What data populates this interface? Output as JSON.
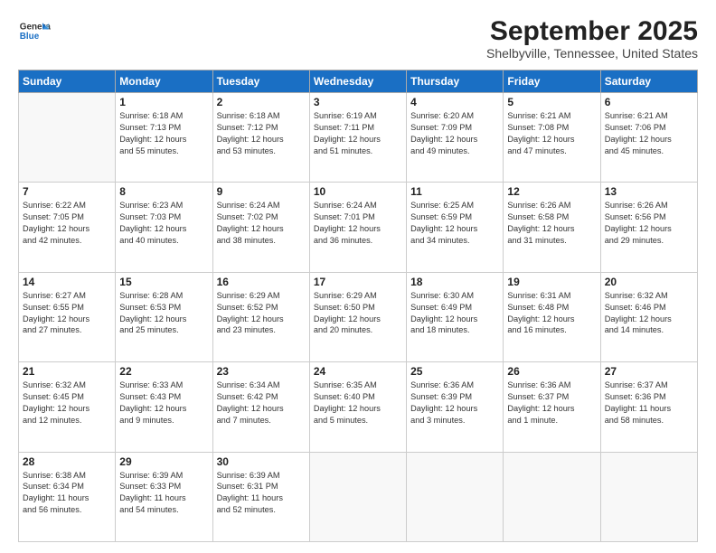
{
  "header": {
    "logo": {
      "general": "General",
      "blue": "Blue"
    },
    "title": "September 2025",
    "subtitle": "Shelbyville, Tennessee, United States"
  },
  "days_of_week": [
    "Sunday",
    "Monday",
    "Tuesday",
    "Wednesday",
    "Thursday",
    "Friday",
    "Saturday"
  ],
  "weeks": [
    [
      {
        "day": "",
        "info": ""
      },
      {
        "day": "1",
        "info": "Sunrise: 6:18 AM\nSunset: 7:13 PM\nDaylight: 12 hours\nand 55 minutes."
      },
      {
        "day": "2",
        "info": "Sunrise: 6:18 AM\nSunset: 7:12 PM\nDaylight: 12 hours\nand 53 minutes."
      },
      {
        "day": "3",
        "info": "Sunrise: 6:19 AM\nSunset: 7:11 PM\nDaylight: 12 hours\nand 51 minutes."
      },
      {
        "day": "4",
        "info": "Sunrise: 6:20 AM\nSunset: 7:09 PM\nDaylight: 12 hours\nand 49 minutes."
      },
      {
        "day": "5",
        "info": "Sunrise: 6:21 AM\nSunset: 7:08 PM\nDaylight: 12 hours\nand 47 minutes."
      },
      {
        "day": "6",
        "info": "Sunrise: 6:21 AM\nSunset: 7:06 PM\nDaylight: 12 hours\nand 45 minutes."
      }
    ],
    [
      {
        "day": "7",
        "info": "Sunrise: 6:22 AM\nSunset: 7:05 PM\nDaylight: 12 hours\nand 42 minutes."
      },
      {
        "day": "8",
        "info": "Sunrise: 6:23 AM\nSunset: 7:03 PM\nDaylight: 12 hours\nand 40 minutes."
      },
      {
        "day": "9",
        "info": "Sunrise: 6:24 AM\nSunset: 7:02 PM\nDaylight: 12 hours\nand 38 minutes."
      },
      {
        "day": "10",
        "info": "Sunrise: 6:24 AM\nSunset: 7:01 PM\nDaylight: 12 hours\nand 36 minutes."
      },
      {
        "day": "11",
        "info": "Sunrise: 6:25 AM\nSunset: 6:59 PM\nDaylight: 12 hours\nand 34 minutes."
      },
      {
        "day": "12",
        "info": "Sunrise: 6:26 AM\nSunset: 6:58 PM\nDaylight: 12 hours\nand 31 minutes."
      },
      {
        "day": "13",
        "info": "Sunrise: 6:26 AM\nSunset: 6:56 PM\nDaylight: 12 hours\nand 29 minutes."
      }
    ],
    [
      {
        "day": "14",
        "info": "Sunrise: 6:27 AM\nSunset: 6:55 PM\nDaylight: 12 hours\nand 27 minutes."
      },
      {
        "day": "15",
        "info": "Sunrise: 6:28 AM\nSunset: 6:53 PM\nDaylight: 12 hours\nand 25 minutes."
      },
      {
        "day": "16",
        "info": "Sunrise: 6:29 AM\nSunset: 6:52 PM\nDaylight: 12 hours\nand 23 minutes."
      },
      {
        "day": "17",
        "info": "Sunrise: 6:29 AM\nSunset: 6:50 PM\nDaylight: 12 hours\nand 20 minutes."
      },
      {
        "day": "18",
        "info": "Sunrise: 6:30 AM\nSunset: 6:49 PM\nDaylight: 12 hours\nand 18 minutes."
      },
      {
        "day": "19",
        "info": "Sunrise: 6:31 AM\nSunset: 6:48 PM\nDaylight: 12 hours\nand 16 minutes."
      },
      {
        "day": "20",
        "info": "Sunrise: 6:32 AM\nSunset: 6:46 PM\nDaylight: 12 hours\nand 14 minutes."
      }
    ],
    [
      {
        "day": "21",
        "info": "Sunrise: 6:32 AM\nSunset: 6:45 PM\nDaylight: 12 hours\nand 12 minutes."
      },
      {
        "day": "22",
        "info": "Sunrise: 6:33 AM\nSunset: 6:43 PM\nDaylight: 12 hours\nand 9 minutes."
      },
      {
        "day": "23",
        "info": "Sunrise: 6:34 AM\nSunset: 6:42 PM\nDaylight: 12 hours\nand 7 minutes."
      },
      {
        "day": "24",
        "info": "Sunrise: 6:35 AM\nSunset: 6:40 PM\nDaylight: 12 hours\nand 5 minutes."
      },
      {
        "day": "25",
        "info": "Sunrise: 6:36 AM\nSunset: 6:39 PM\nDaylight: 12 hours\nand 3 minutes."
      },
      {
        "day": "26",
        "info": "Sunrise: 6:36 AM\nSunset: 6:37 PM\nDaylight: 12 hours\nand 1 minute."
      },
      {
        "day": "27",
        "info": "Sunrise: 6:37 AM\nSunset: 6:36 PM\nDaylight: 11 hours\nand 58 minutes."
      }
    ],
    [
      {
        "day": "28",
        "info": "Sunrise: 6:38 AM\nSunset: 6:34 PM\nDaylight: 11 hours\nand 56 minutes."
      },
      {
        "day": "29",
        "info": "Sunrise: 6:39 AM\nSunset: 6:33 PM\nDaylight: 11 hours\nand 54 minutes."
      },
      {
        "day": "30",
        "info": "Sunrise: 6:39 AM\nSunset: 6:31 PM\nDaylight: 11 hours\nand 52 minutes."
      },
      {
        "day": "",
        "info": ""
      },
      {
        "day": "",
        "info": ""
      },
      {
        "day": "",
        "info": ""
      },
      {
        "day": "",
        "info": ""
      }
    ]
  ]
}
